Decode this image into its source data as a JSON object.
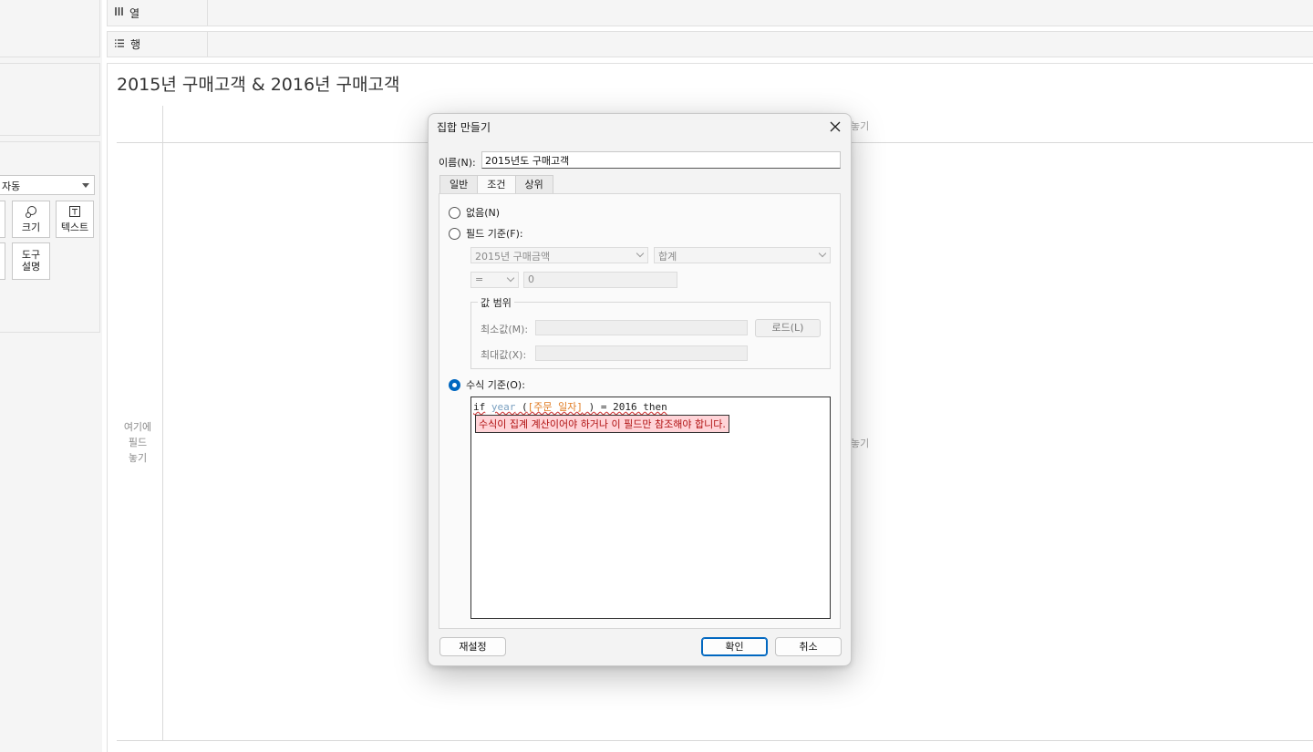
{
  "shelves": {
    "columns": {
      "icon": "columns-icon",
      "label": "열"
    },
    "rows": {
      "icon": "rows-icon",
      "label": "행"
    }
  },
  "marks": {
    "type_value": "자동",
    "buttons": {
      "size": "크기",
      "text": "텍스트",
      "tooltip": "도구\n설명"
    }
  },
  "sheet": {
    "title": "2015년 구매고객 & 2016년 구매고객",
    "drop_hint_left": "여기에\n필드\n놓기",
    "drop_hint_right_top": "놓기",
    "drop_hint_right_mid": "놓기"
  },
  "dialog": {
    "title": "집합 만들기",
    "name_label": "이름(N):",
    "name_value": "2015년도 구매고객",
    "tabs": [
      "일반",
      "조건",
      "상위"
    ],
    "active_tab": "조건",
    "options": {
      "none": "없음(N)",
      "by_field": "필드 기준(F):",
      "by_formula": "수식 기준(O):"
    },
    "selected_option": "by_formula",
    "field_select": "2015년 구매금액",
    "aggregate_select": "합계",
    "operator_select": "=",
    "value_input": "0",
    "range": {
      "legend": "값 범위",
      "min_label": "최소값(M):",
      "max_label": "최대값(X):",
      "load_label": "로드(L)"
    },
    "formula": {
      "kw_if": "if",
      "fn_year": "year",
      "open_paren": " (",
      "field": "[주문 일자]",
      "rest": " ) = 2016 then",
      "error": "수식이 집계 계산이어야 하거나 이 필드만 참조해야 합니다."
    },
    "buttons": {
      "reset": "재설정",
      "ok": "확인",
      "cancel": "취소"
    }
  },
  "colors": {
    "accent": "#0067c0",
    "error_bg": "#ffd4d8",
    "error_text": "#b01010",
    "field": "#e07b22"
  }
}
